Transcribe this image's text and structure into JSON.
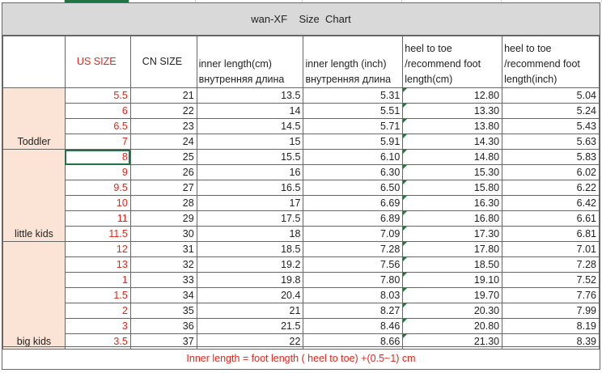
{
  "title": "wan-XF    Size  Chart",
  "headers": {
    "us": "US  SIZE",
    "cn": "CN  SIZE",
    "inner_cm": [
      "inner length(cm)",
      "внутренняя длина"
    ],
    "inner_inch": [
      "inner length (inch)",
      "внутренняя длина"
    ],
    "heel_cm": [
      "heel to toe",
      "/recommend foot",
      "length(cm)"
    ],
    "heel_inch": [
      "heel to toe",
      "/recommend foot",
      "length(inch)"
    ]
  },
  "groups": [
    {
      "label": "Toddler",
      "rows": [
        {
          "us": "5.5",
          "cn": "21",
          "cm": "13.5",
          "in": "5.31",
          "hcm": "12.80",
          "hin": "5.04"
        },
        {
          "us": "6",
          "cn": "22",
          "cm": "14",
          "in": "5.51",
          "hcm": "13.30",
          "hin": "5.24"
        },
        {
          "us": "6.5",
          "cn": "23",
          "cm": "14.5",
          "in": "5.71",
          "hcm": "13.80",
          "hin": "5.43"
        },
        {
          "us": "7",
          "cn": "24",
          "cm": "15",
          "in": "5.91",
          "hcm": "14.30",
          "hin": "5.63"
        }
      ]
    },
    {
      "label": "little kids",
      "rows": [
        {
          "us": "8",
          "cn": "25",
          "cm": "15.5",
          "in": "6.10",
          "hcm": "14.80",
          "hin": "5.83"
        },
        {
          "us": "9",
          "cn": "26",
          "cm": "16",
          "in": "6.30",
          "hcm": "15.30",
          "hin": "6.02"
        },
        {
          "us": "9.5",
          "cn": "27",
          "cm": "16.5",
          "in": "6.50",
          "hcm": "15.80",
          "hin": "6.22"
        },
        {
          "us": "10",
          "cn": "28",
          "cm": "17",
          "in": "6.69",
          "hcm": "16.30",
          "hin": "6.42"
        },
        {
          "us": "11",
          "cn": "29",
          "cm": "17.5",
          "in": "6.89",
          "hcm": "16.80",
          "hin": "6.61"
        },
        {
          "us": "11.5",
          "cn": "30",
          "cm": "18",
          "in": "7.09",
          "hcm": "17.30",
          "hin": "6.81"
        }
      ]
    },
    {
      "label": "big kids",
      "rows": [
        {
          "us": "12",
          "cn": "31",
          "cm": "18.5",
          "in": "7.28",
          "hcm": "17.80",
          "hin": "7.01"
        },
        {
          "us": "13",
          "cn": "32",
          "cm": "19.2",
          "in": "7.56",
          "hcm": "18.50",
          "hin": "7.28"
        },
        {
          "us": "1",
          "cn": "33",
          "cm": "19.8",
          "in": "7.80",
          "hcm": "19.10",
          "hin": "7.52"
        },
        {
          "us": "1.5",
          "cn": "34",
          "cm": "20.4",
          "in": "8.03",
          "hcm": "19.70",
          "hin": "7.76"
        },
        {
          "us": "2",
          "cn": "35",
          "cm": "21",
          "in": "8.27",
          "hcm": "20.30",
          "hin": "7.99"
        },
        {
          "us": "3",
          "cn": "36",
          "cm": "21.5",
          "in": "8.46",
          "hcm": "20.80",
          "hin": "8.19"
        },
        {
          "us": "3.5",
          "cn": "37",
          "cm": "22",
          "in": "8.66",
          "hcm": "21.30",
          "hin": "8.39"
        }
      ]
    }
  ],
  "footer": "Inner length = foot length ( heel to toe)  +(0.5~1) cm",
  "selected_cell": {
    "group": 1,
    "row": 0,
    "column": "US  SIZE"
  },
  "colors": {
    "accent_red": "#e2261c",
    "group_fill": "#fbe4d5",
    "header_fill": "#d9d9d9",
    "selection": "#217346"
  }
}
